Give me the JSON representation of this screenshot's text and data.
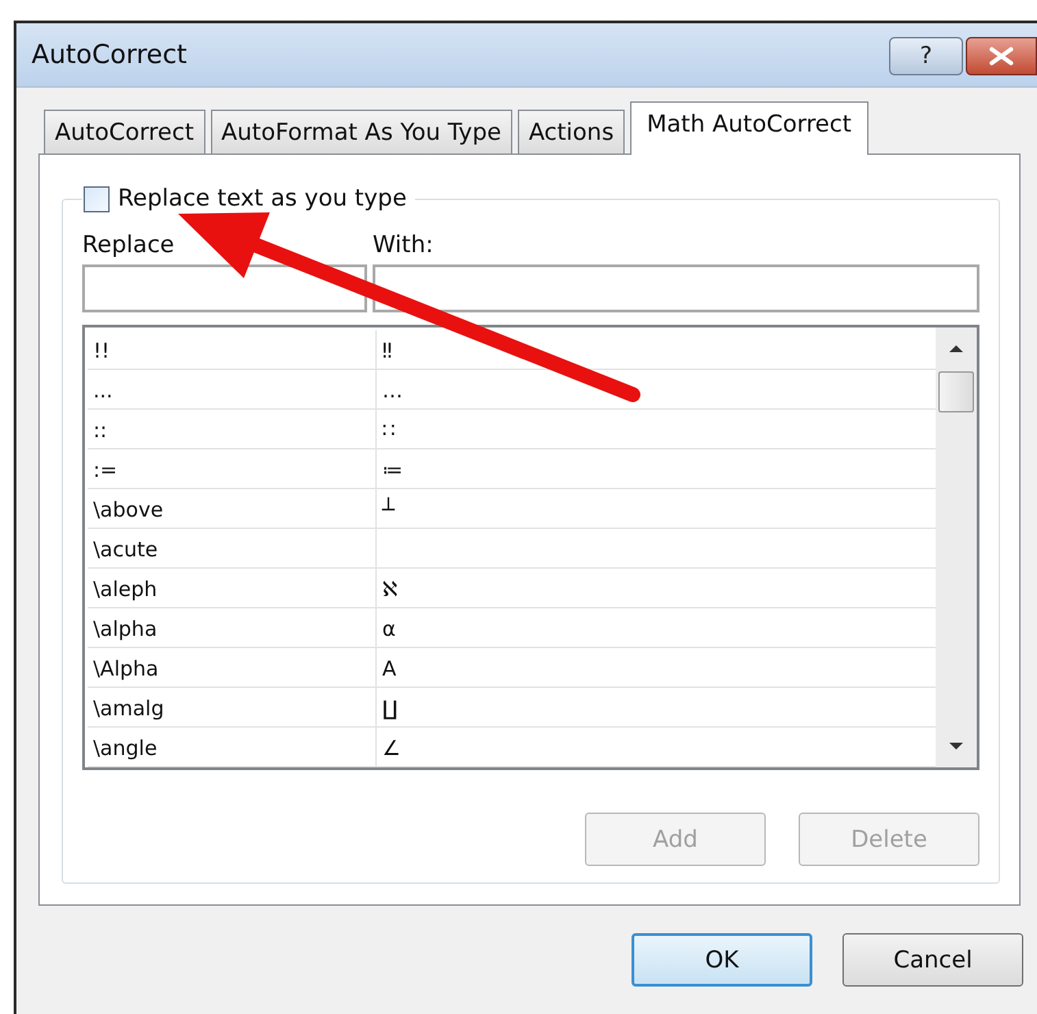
{
  "window": {
    "title": "AutoCorrect",
    "help": "?"
  },
  "tabs": [
    {
      "label": "AutoCorrect",
      "selected": false
    },
    {
      "label": "AutoFormat As You Type",
      "selected": false
    },
    {
      "label": "Actions",
      "selected": false
    },
    {
      "label": "Math AutoCorrect",
      "selected": true
    }
  ],
  "replace_option": {
    "label": "Replace text as you type",
    "checked": false
  },
  "columns": [
    "Replace",
    "With:"
  ],
  "rows": [
    {
      "replace": "!!",
      "with": "‼"
    },
    {
      "replace": "...",
      "with": "…"
    },
    {
      "replace": "::",
      "with": "∷"
    },
    {
      "replace": ":=",
      "with": "≔"
    },
    {
      "replace": "\\above",
      "with": "┴"
    },
    {
      "replace": "\\acute"
    },
    {
      "replace": "\\aleph",
      "with": "ℵ"
    },
    {
      "replace": "\\alpha",
      "with": "α"
    },
    {
      "replace": "\\Alpha",
      "with": "Α"
    },
    {
      "replace": "\\amalg",
      "with": "∐"
    },
    {
      "replace": "\\angle",
      "with": "∠"
    }
  ],
  "list_buttons": [
    {
      "label": "Add",
      "disabled": true
    },
    {
      "label": "Delete",
      "disabled": true
    }
  ],
  "dialog_buttons": [
    {
      "label": "OK",
      "default": true
    },
    {
      "label": "Cancel",
      "default": false
    }
  ]
}
